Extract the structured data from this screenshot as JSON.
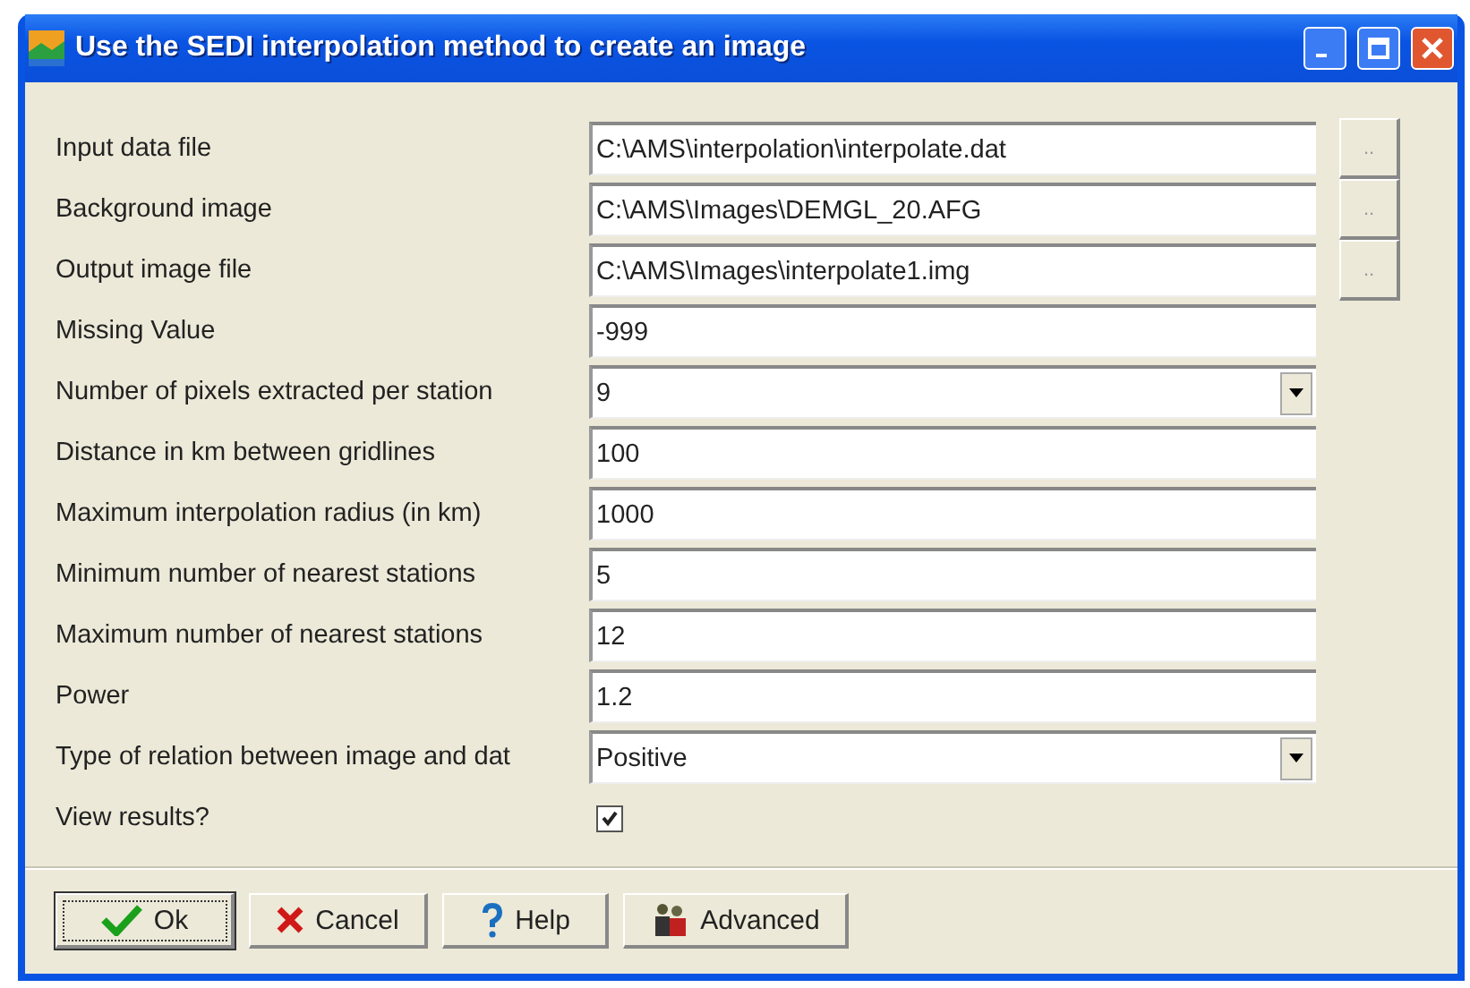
{
  "window": {
    "title": "Use the SEDI interpolation method to create an image"
  },
  "fields": [
    {
      "kind": "browse",
      "label": "Input data file",
      "value": "C:\\AMS\\interpolation\\interpolate.dat",
      "button": ".."
    },
    {
      "kind": "browse",
      "label": "Background image",
      "value": "C:\\AMS\\Images\\DEMGL_20.AFG",
      "button": ".."
    },
    {
      "kind": "browse",
      "label": "Output image file",
      "value": "C:\\AMS\\Images\\interpolate1.img",
      "button": ".."
    },
    {
      "kind": "text",
      "label": "Missing Value",
      "value": "-999"
    },
    {
      "kind": "select",
      "label": "Number of pixels extracted per station",
      "value": "9"
    },
    {
      "kind": "text",
      "label": "Distance in km between gridlines",
      "value": "100"
    },
    {
      "kind": "text",
      "label": "Maximum interpolation radius (in km)",
      "value": "1000"
    },
    {
      "kind": "text",
      "label": "Minimum number of nearest stations",
      "value": "5"
    },
    {
      "kind": "text",
      "label": "Maximum number of nearest stations",
      "value": "12"
    },
    {
      "kind": "text",
      "label": "Power",
      "value": "1.2"
    },
    {
      "kind": "select",
      "label": "Type of relation between image and dat",
      "value": "Positive"
    },
    {
      "kind": "checkbox",
      "label": "View results?",
      "checked": true
    }
  ],
  "buttons": [
    {
      "kind": "ok",
      "label": "Ok",
      "default": true
    },
    {
      "kind": "cancel",
      "label": "Cancel",
      "default": false
    },
    {
      "kind": "help",
      "label": "Help",
      "default": false
    },
    {
      "kind": "advanced",
      "label": "Advanced",
      "default": false
    }
  ]
}
